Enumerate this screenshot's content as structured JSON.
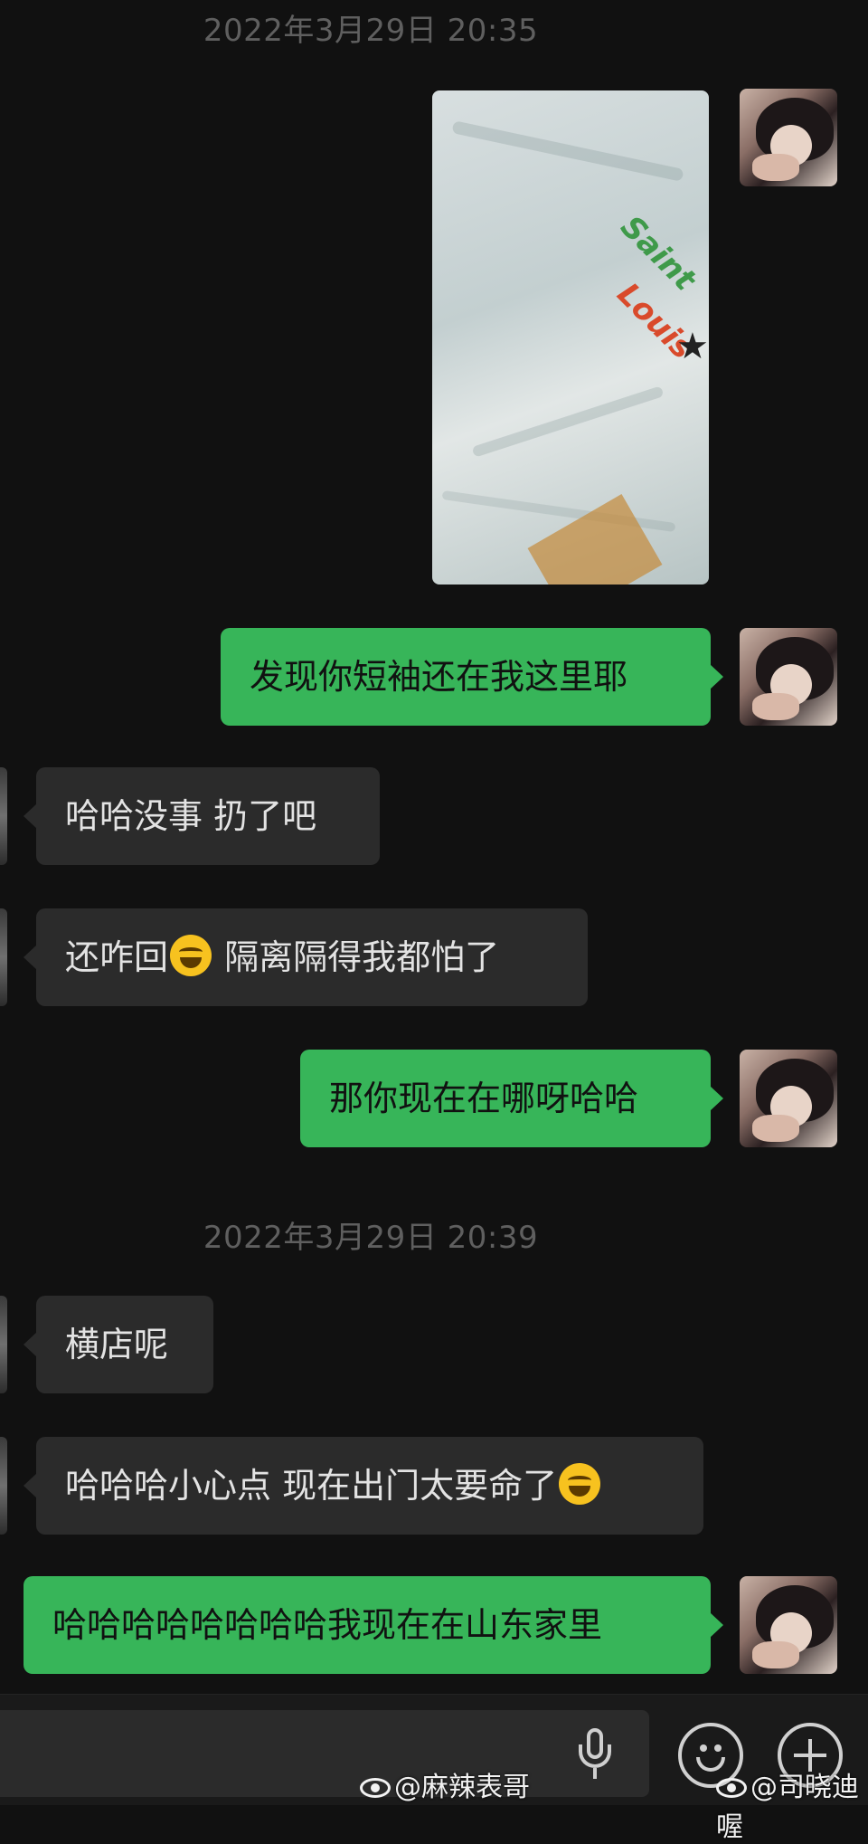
{
  "timestamps": [
    "2022年3月29日 20:35",
    "2022年3月29日 20:39"
  ],
  "photo": {
    "logo_line1": "Saint",
    "logo_line2": "Louis"
  },
  "messages": [
    {
      "side": "out",
      "text": "发现你短袖还在我这里耶"
    },
    {
      "side": "in",
      "text": "哈哈没事 扔了吧"
    },
    {
      "side": "in",
      "text_before": "还咋回",
      "emoji": "joy-emoji",
      "text_after": " 隔离隔得我都怕了"
    },
    {
      "side": "out",
      "text": "那你现在在哪呀哈哈"
    },
    {
      "side": "in",
      "text": "横店呢"
    },
    {
      "side": "in",
      "text": "哈哈哈小心点 现在出门太要命了",
      "emoji": "joy-emoji"
    },
    {
      "side": "out",
      "text": "哈哈哈哈哈哈哈哈我现在在山东家里"
    }
  ],
  "watermarks": [
    "@麻辣表哥",
    "@司晓迪喔"
  ],
  "colors": {
    "outgoing_bubble": "#37b559",
    "incoming_bubble": "#2b2b2b",
    "background": "#111111"
  }
}
